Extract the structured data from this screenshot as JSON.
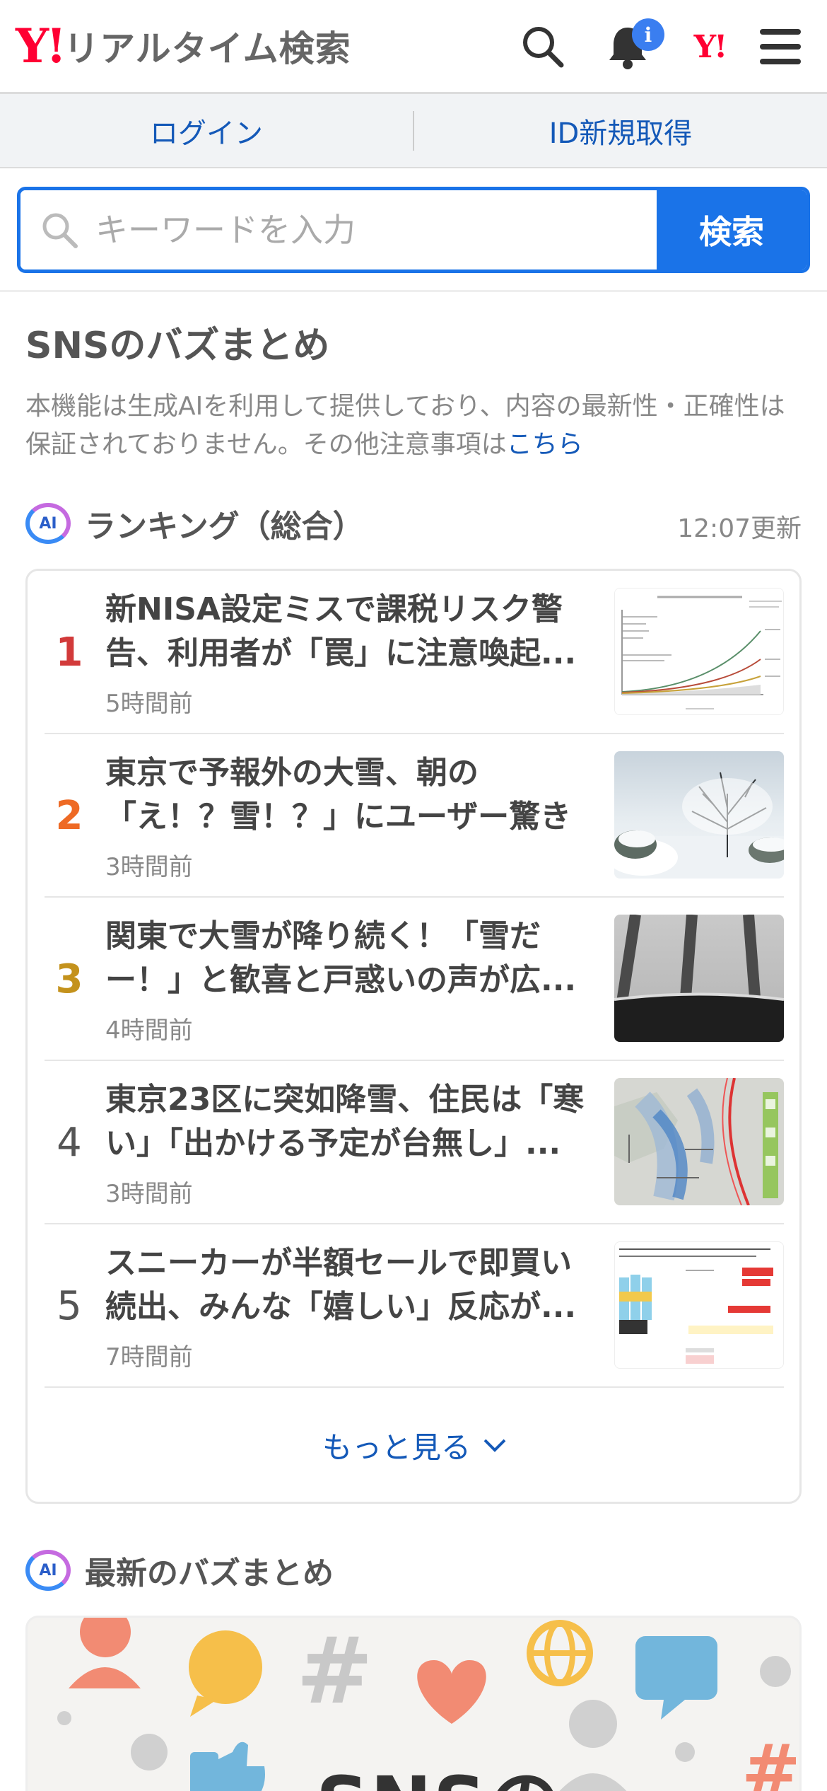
{
  "header": {
    "logo_mark": "Y!",
    "logo_text": "リアルタイム検索",
    "notification_badge": "i",
    "yahoo_mark": "Y!",
    "icons": [
      "search-icon",
      "bell-icon",
      "yahoo-japan-icon",
      "hamburger-menu-icon"
    ]
  },
  "account": {
    "login_label": "ログイン",
    "signup_label": "ID新規取得"
  },
  "search": {
    "placeholder": "キーワードを入力",
    "value": "",
    "button_label": "検索"
  },
  "section": {
    "title": "SNSのバズまとめ",
    "notice_text": "本機能は生成AIを利用して提供しており、内容の最新性・正確性は保証されておりません。その他注意事項は",
    "notice_link": "こちら"
  },
  "ranking": {
    "ai_label": "AI",
    "title": "ランキング（総合）",
    "updated": "12:07更新",
    "items": [
      {
        "rank": "1",
        "title": "新NISA設定ミスで課税リスク警告、利用者が「罠」に注意喚起...",
        "time": "5時間前",
        "thumb": "chart-thumbnail"
      },
      {
        "rank": "2",
        "title": "東京で予報外の大雪、朝の「え！？雪！？」にユーザー驚き",
        "time": "3時間前",
        "thumb": "snowy-tree-thumbnail"
      },
      {
        "rank": "3",
        "title": "関東で大雪が降り続く！「雪だー！」と歓喜と戸惑いの声が広...",
        "time": "4時間前",
        "thumb": "snowy-car-thumbnail"
      },
      {
        "rank": "4",
        "title": "東京23区に突如降雪、住民は「寒い」「出かける予定が台無し」...",
        "time": "3時間前",
        "thumb": "weather-map-thumbnail"
      },
      {
        "rank": "5",
        "title": "スニーカーが半額セールで即買い続出、みんな「嬉しい」反応が...",
        "time": "7時間前",
        "thumb": "shopping-page-thumbnail"
      }
    ],
    "more_label": "もっと見る"
  },
  "latest": {
    "ai_label": "AI",
    "title": "最新のバズまとめ",
    "banner_text": "SNSの"
  },
  "colors": {
    "brand_red": "#ff0033",
    "accent_blue": "#1a73e8",
    "link_blue": "#1459b8",
    "rank1": "#d23a3a",
    "rank2": "#ee6a25",
    "rank3": "#c4921c"
  }
}
